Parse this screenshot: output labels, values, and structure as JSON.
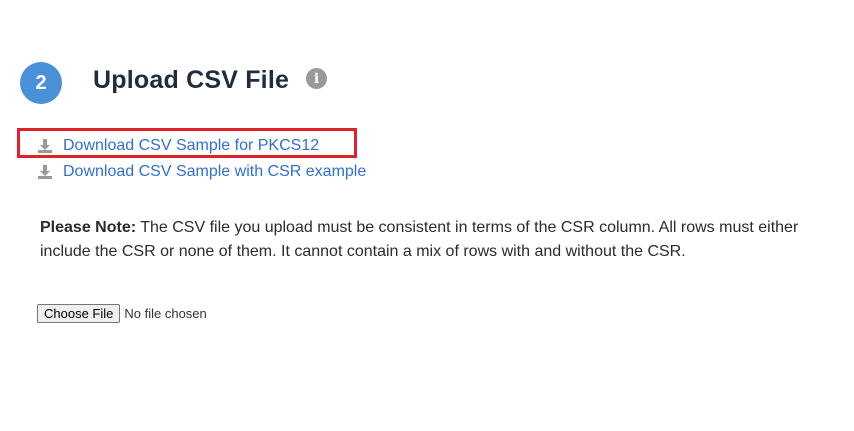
{
  "step": {
    "number": "2",
    "title": "Upload CSV File"
  },
  "icons": {
    "info": "info-icon",
    "download": "download-icon"
  },
  "downloads": [
    {
      "label": "Download CSV Sample for PKCS12"
    },
    {
      "label": "Download CSV Sample with CSR example"
    }
  ],
  "note": {
    "label": "Please Note:",
    "text": " The CSV file you upload must be consistent in terms of the CSR column. All rows must either include the CSR or none of them. It cannot contain a mix of rows with and without the CSR."
  },
  "file_input": {
    "button_label": "Choose File",
    "status": "No file chosen"
  },
  "colors": {
    "accent": "#4a90d9",
    "link": "#2f6fd6",
    "highlight": "#e0232b",
    "info": "#9a9a9a"
  }
}
